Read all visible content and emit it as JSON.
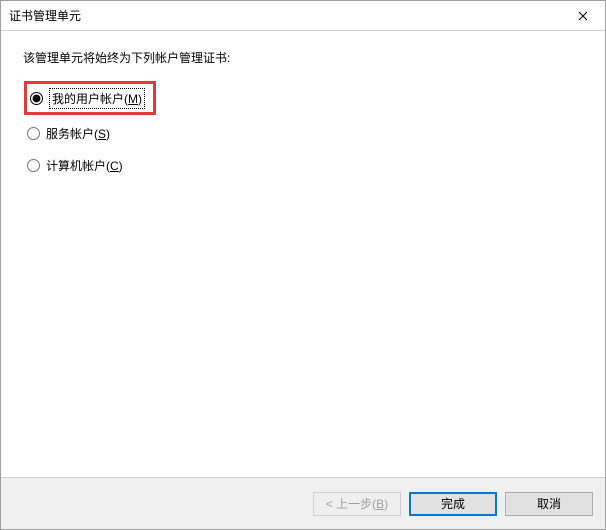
{
  "titlebar": {
    "title": "证书管理单元"
  },
  "instruction": "该管理单元将始终为下列帐户管理证书:",
  "options": {
    "myUser": {
      "label_pre": "我的用户帐户(",
      "mnemonic": "M",
      "label_post": ")",
      "checked": true
    },
    "service": {
      "label_pre": "服务帐户(",
      "mnemonic": "S",
      "label_post": ")",
      "checked": false
    },
    "computer": {
      "label_pre": "计算机帐户(",
      "mnemonic": "C",
      "label_post": ")",
      "checked": false
    }
  },
  "buttons": {
    "back": {
      "label_pre": "< 上一步(",
      "mnemonic": "B",
      "label_post": ")",
      "enabled": false
    },
    "finish": {
      "label": "完成",
      "enabled": true,
      "default": true
    },
    "cancel": {
      "label": "取消",
      "enabled": true
    }
  }
}
